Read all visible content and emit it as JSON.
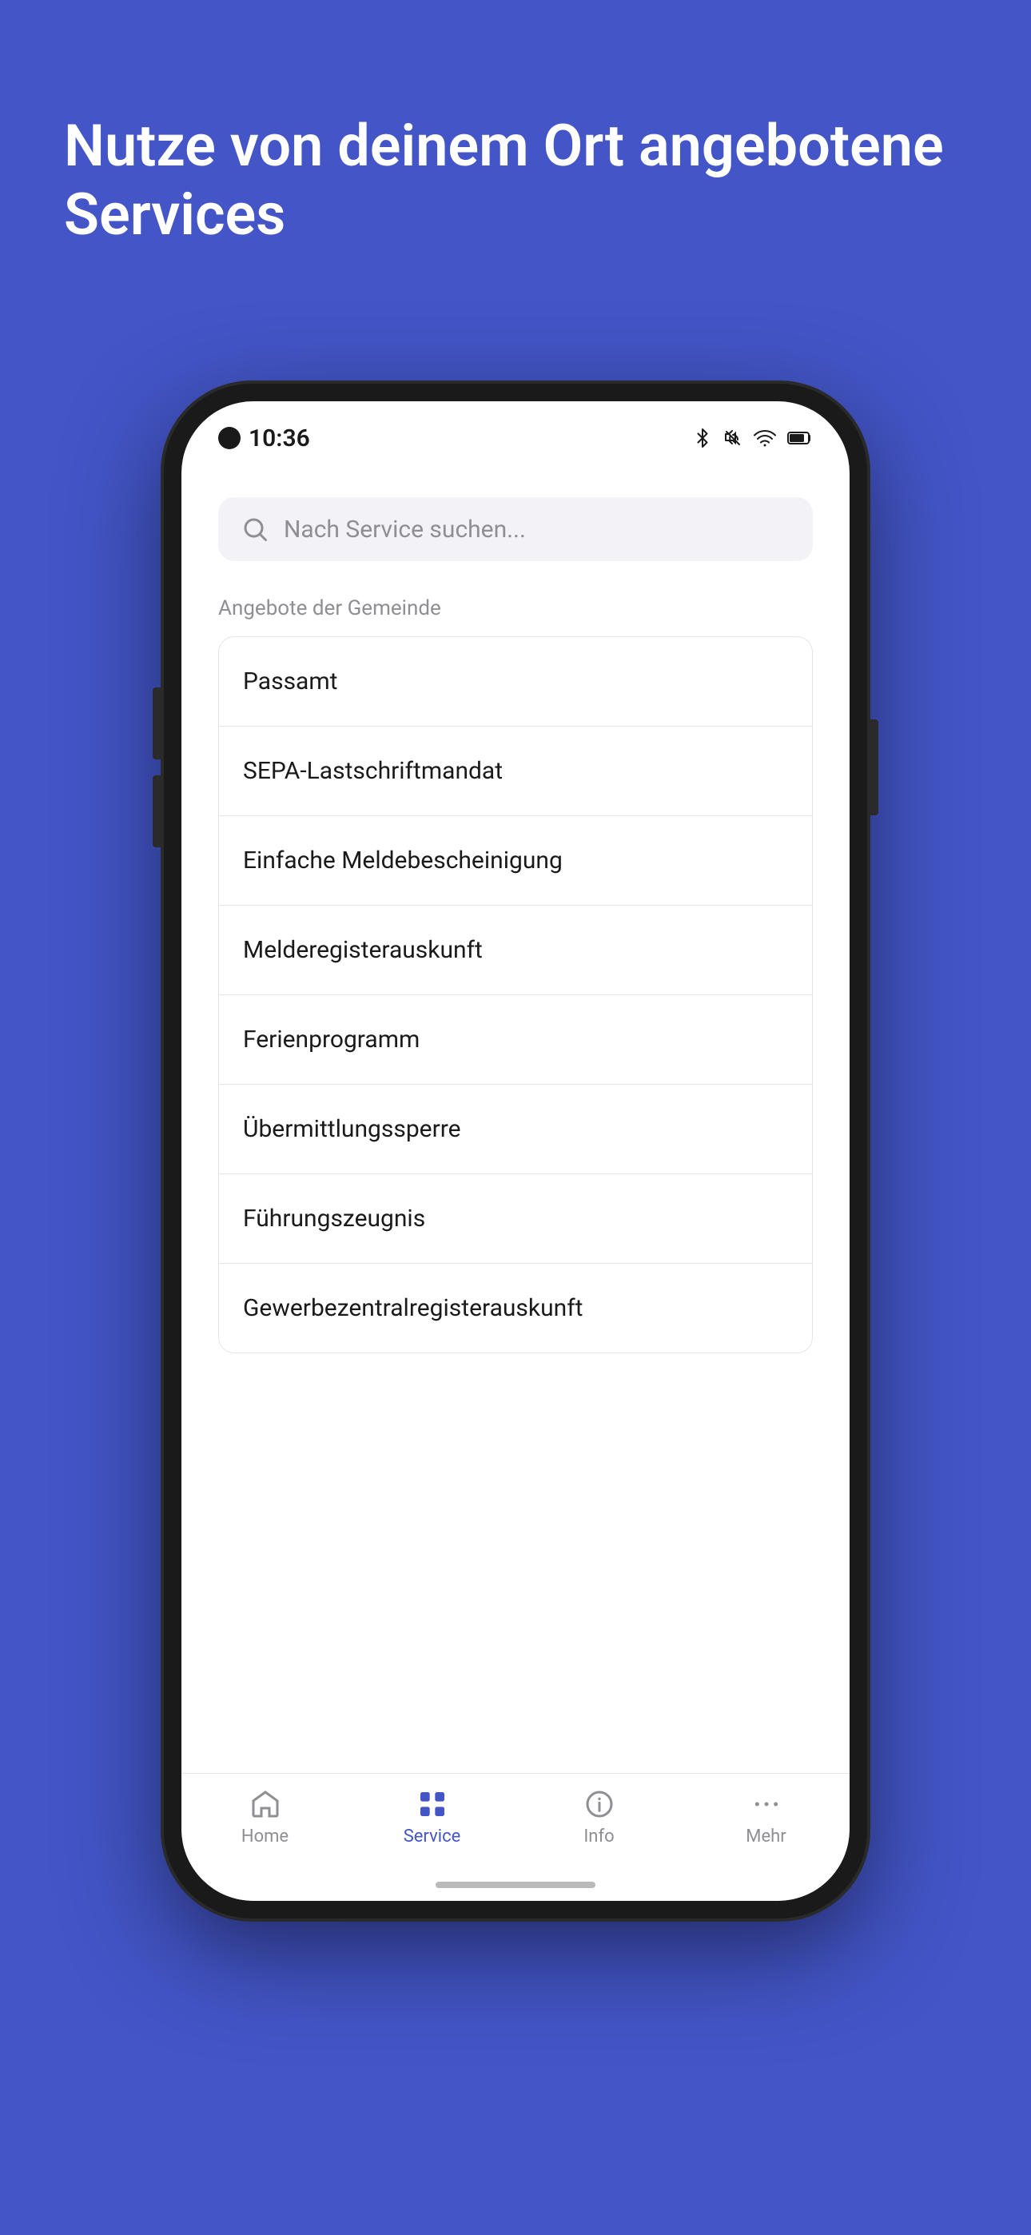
{
  "background": {
    "color": "#4355c7"
  },
  "headline": {
    "text": "Nutze von deinem Ort angebotene Services"
  },
  "status_bar": {
    "time": "10:36",
    "icons": [
      "bluetooth",
      "mute",
      "wifi",
      "battery"
    ]
  },
  "search": {
    "placeholder": "Nach Service suchen..."
  },
  "section": {
    "header": "Angebote der Gemeinde"
  },
  "services": [
    {
      "id": 1,
      "label": "Passamt"
    },
    {
      "id": 2,
      "label": "SEPA-Lastschriftmandat"
    },
    {
      "id": 3,
      "label": "Einfache Meldebescheinigung"
    },
    {
      "id": 4,
      "label": "Melderegisterauskunft"
    },
    {
      "id": 5,
      "label": "Ferienprogramm"
    },
    {
      "id": 6,
      "label": "Übermittlungssperre"
    },
    {
      "id": 7,
      "label": "Führungszeugnis"
    },
    {
      "id": 8,
      "label": "Gewerbezentralregisterauskunft"
    }
  ],
  "tabs": [
    {
      "id": "home",
      "label": "Home",
      "active": false
    },
    {
      "id": "service",
      "label": "Service",
      "active": true
    },
    {
      "id": "info",
      "label": "Info",
      "active": false
    },
    {
      "id": "mehr",
      "label": "Mehr",
      "active": false
    }
  ]
}
